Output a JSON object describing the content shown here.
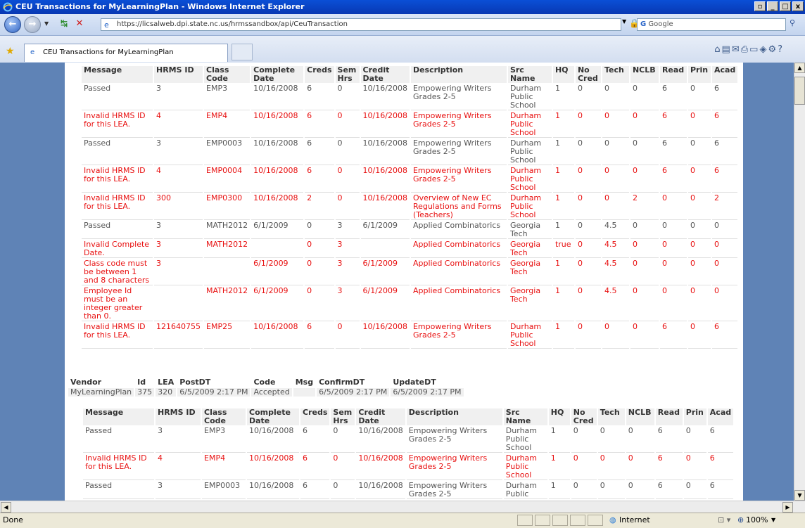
{
  "window": {
    "title": "CEU Transactions for MyLearningPlan - Windows Internet Explorer"
  },
  "address": {
    "url": "https://licsalweb.dpi.state.nc.us/hrmssandbox/api/CeuTransaction",
    "search_placeholder": "Google"
  },
  "tab": {
    "label": "CEU Transactions for MyLearningPlan"
  },
  "headers": [
    "Message",
    "HRMS ID",
    "Class Code",
    "Complete Date",
    "Creds",
    "Sem Hrs",
    "Credit Date",
    "Description",
    "Src Name",
    "HQ",
    "No Cred",
    "Tech",
    "NCLB",
    "Read",
    "Prin",
    "Acad"
  ],
  "rows1": [
    {
      "err": false,
      "c": [
        "Passed",
        "3",
        "EMP3",
        "10/16/2008",
        "6",
        "0",
        "10/16/2008",
        "Empowering Writers Grades 2-5",
        "Durham Public School",
        "1",
        "0",
        "0",
        "0",
        "6",
        "0",
        "6"
      ]
    },
    {
      "err": true,
      "c": [
        "Invalid HRMS ID for this LEA.",
        "4",
        "EMP4",
        "10/16/2008",
        "6",
        "0",
        "10/16/2008",
        "Empowering Writers Grades 2-5",
        "Durham Public School",
        "1",
        "0",
        "0",
        "0",
        "6",
        "0",
        "6"
      ]
    },
    {
      "err": false,
      "c": [
        "Passed",
        "3",
        "EMP0003",
        "10/16/2008",
        "6",
        "0",
        "10/16/2008",
        "Empowering Writers Grades 2-5",
        "Durham Public School",
        "1",
        "0",
        "0",
        "0",
        "6",
        "0",
        "6"
      ]
    },
    {
      "err": true,
      "c": [
        "Invalid HRMS ID for this LEA.",
        "4",
        "EMP0004",
        "10/16/2008",
        "6",
        "0",
        "10/16/2008",
        "Empowering Writers Grades 2-5",
        "Durham Public School",
        "1",
        "0",
        "0",
        "0",
        "6",
        "0",
        "6"
      ]
    },
    {
      "err": true,
      "c": [
        "Invalid HRMS ID for this LEA.",
        "300",
        "EMP0300",
        "10/16/2008",
        "2",
        "0",
        "10/16/2008",
        "Overview of New EC Regulations and Forms (Teachers)",
        "Durham Public School",
        "1",
        "0",
        "0",
        "2",
        "0",
        "0",
        "2"
      ]
    },
    {
      "err": false,
      "c": [
        "Passed",
        "3",
        "MATH2012",
        "6/1/2009",
        "0",
        "3",
        "6/1/2009",
        "Applied Combinatorics",
        "Georgia Tech",
        "1",
        "0",
        "4.5",
        "0",
        "0",
        "0",
        "0"
      ]
    },
    {
      "err": true,
      "c": [
        "Invalid Complete Date.",
        "3",
        "MATH2012",
        "",
        "0",
        "3",
        "",
        "Applied Combinatorics",
        "Georgia Tech",
        "true",
        "0",
        "4.5",
        "0",
        "0",
        "0",
        "0"
      ]
    },
    {
      "err": true,
      "c": [
        "Class code must be between 1 and 8 characters",
        "3",
        "",
        "6/1/2009",
        "0",
        "3",
        "6/1/2009",
        "Applied Combinatorics",
        "Georgia Tech",
        "1",
        "0",
        "4.5",
        "0",
        "0",
        "0",
        "0"
      ]
    },
    {
      "err": true,
      "c": [
        "Employee Id must be an integer greater than 0.",
        "",
        "MATH2012",
        "6/1/2009",
        "0",
        "3",
        "6/1/2009",
        "Applied Combinatorics",
        "Georgia Tech",
        "1",
        "0",
        "4.5",
        "0",
        "0",
        "0",
        "0"
      ]
    },
    {
      "err": true,
      "c": [
        "Invalid HRMS ID for this LEA.",
        "121640755",
        "EMP25",
        "10/16/2008",
        "6",
        "0",
        "10/16/2008",
        "Empowering Writers Grades 2-5",
        "Durham Public School",
        "1",
        "0",
        "0",
        "0",
        "6",
        "0",
        "6"
      ]
    }
  ],
  "vendor": {
    "headers": [
      "Vendor",
      "Id",
      "LEA",
      "PostDT",
      "Code",
      "Msg",
      "ConfirmDT",
      "UpdateDT"
    ],
    "row": [
      "MyLearningPlan",
      "375",
      "320",
      "6/5/2009 2:17 PM",
      "Accepted",
      "",
      "6/5/2009 2:17 PM",
      "6/5/2009 2:17 PM"
    ]
  },
  "rows2": [
    {
      "err": false,
      "c": [
        "Passed",
        "3",
        "EMP3",
        "10/16/2008",
        "6",
        "0",
        "10/16/2008",
        "Empowering Writers Grades 2-5",
        "Durham Public School",
        "1",
        "0",
        "0",
        "0",
        "6",
        "0",
        "6"
      ]
    },
    {
      "err": true,
      "c": [
        "Invalid HRMS ID for this LEA.",
        "4",
        "EMP4",
        "10/16/2008",
        "6",
        "0",
        "10/16/2008",
        "Empowering Writers Grades 2-5",
        "Durham Public School",
        "1",
        "0",
        "0",
        "0",
        "6",
        "0",
        "6"
      ]
    },
    {
      "err": false,
      "c": [
        "Passed",
        "3",
        "EMP0003",
        "10/16/2008",
        "6",
        "0",
        "10/16/2008",
        "Empowering Writers Grades 2-5",
        "Durham Public",
        "1",
        "0",
        "0",
        "0",
        "6",
        "0",
        "6"
      ]
    }
  ],
  "status": {
    "left": "Done",
    "zone": "Internet",
    "zoom": "100%"
  },
  "colors": {
    "error": "#e81010",
    "normal": "#555555",
    "page_bg": "#5f83b6"
  }
}
